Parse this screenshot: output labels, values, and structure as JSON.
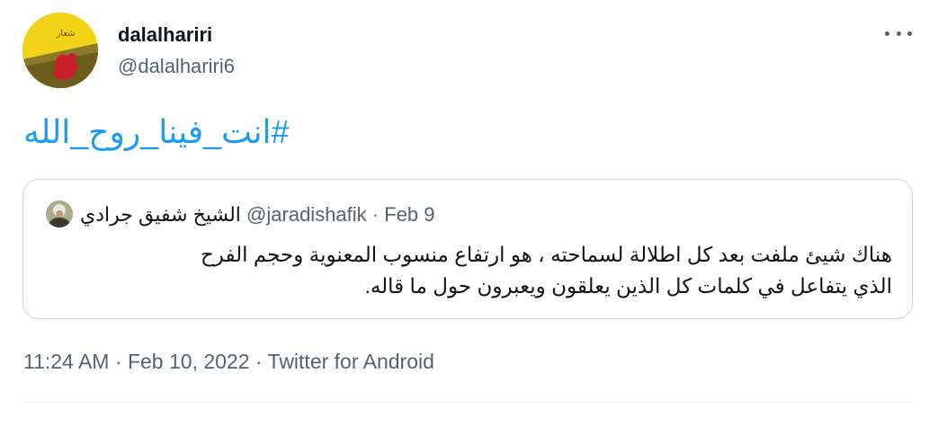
{
  "tweet": {
    "author": {
      "display_name": "dalalhariri",
      "handle": "@dalalhariri6"
    },
    "text": "#انت_فينا_روح_الله",
    "quoted": {
      "display_name": "الشيخ شفيق جرادي",
      "handle": "@jaradishafik",
      "separator": "·",
      "date": "Feb 9",
      "text_line1": "هناك شيئ ملفت بعد كل اطلالة لسماحته ، هو ارتفاع منسوب المعنوية وحجم الفرح",
      "text_line2": "الذي يتفاعل في كلمات كل الذين يعلقون ويعبرون حول ما قاله."
    },
    "meta": {
      "time": "11:24 AM",
      "sep1": "·",
      "date": "Feb 10, 2022",
      "sep2": "·",
      "source": "Twitter for Android"
    }
  },
  "icons": {
    "more": "more-horizontal-icon"
  },
  "colors": {
    "accent": "#1d9bf0",
    "secondary_text": "#536471",
    "border": "#cfd9de"
  }
}
